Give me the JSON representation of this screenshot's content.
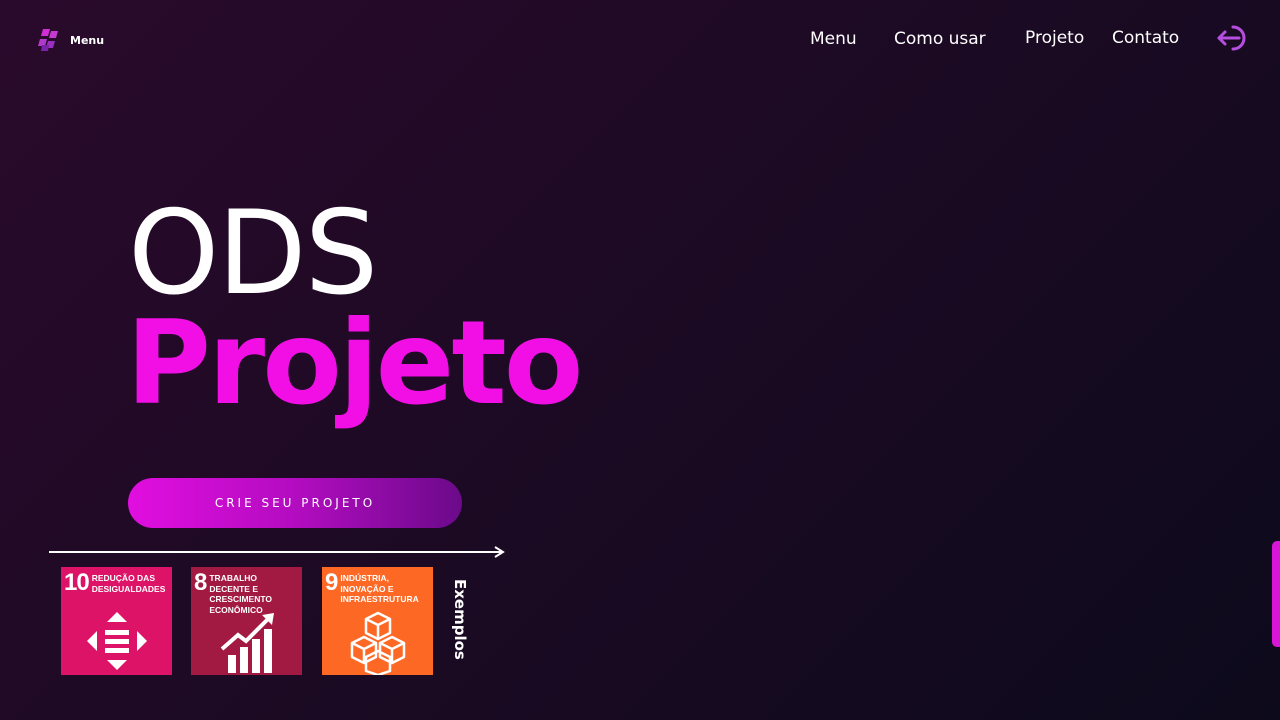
{
  "header": {
    "logo_label": "Menu",
    "nav": [
      {
        "label": "Menu"
      },
      {
        "label": "Como usar"
      },
      {
        "label": "Projeto"
      },
      {
        "label": "Contato"
      }
    ],
    "logout_icon": "logout-arrow-icon"
  },
  "hero": {
    "title_line1": "ODS",
    "title_line2": "Projeto",
    "cta_label": "CRIE SEU PROJETO"
  },
  "examples": {
    "label": "Exemplos",
    "cards": [
      {
        "number": "10",
        "label": "Redução das desigualdades",
        "color": "#dd1367",
        "icon": "equality-arrows-icon"
      },
      {
        "number": "8",
        "label": "Trabalho decente e crescimento econômico",
        "color": "#a21942",
        "icon": "growth-chart-icon"
      },
      {
        "number": "9",
        "label": "Indústria, inovação e infraestrutura",
        "color": "#fd6925",
        "icon": "cubes-icon"
      }
    ]
  },
  "colors": {
    "accent": "#f20fe6",
    "background": "#1d0a24"
  }
}
